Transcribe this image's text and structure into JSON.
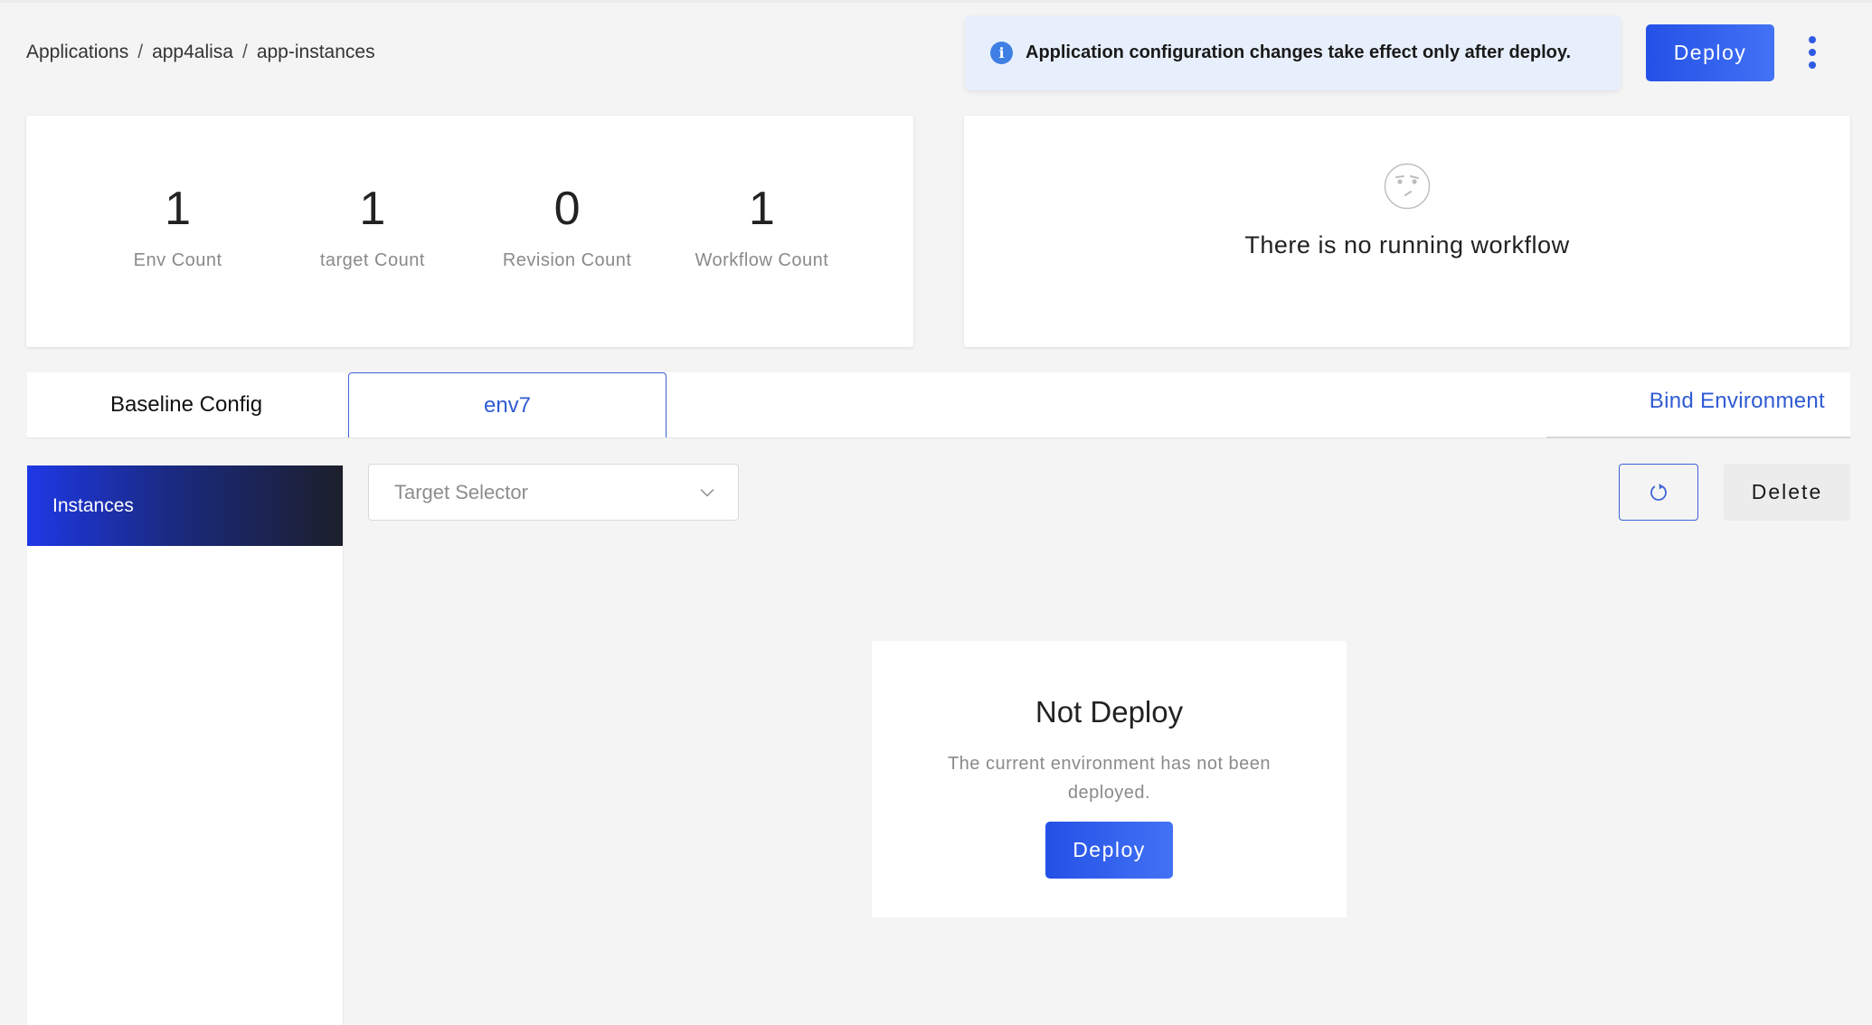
{
  "breadcrumb": [
    {
      "label": "Applications"
    },
    {
      "label": "app4alisa"
    },
    {
      "label": "app-instances"
    }
  ],
  "breadcrumb_separator": "/",
  "banner": {
    "icon": "info-icon",
    "message": "Application configuration changes take effect only after deploy."
  },
  "header": {
    "deploy_label": "Deploy",
    "more_icon": "kebab-menu-icon"
  },
  "stats": [
    {
      "value": "1",
      "label": "Env Count"
    },
    {
      "value": "1",
      "label": "target Count"
    },
    {
      "value": "0",
      "label": "Revision Count"
    },
    {
      "value": "1",
      "label": "Workflow Count"
    }
  ],
  "workflow": {
    "icon": "confused-face-icon",
    "message": "There is no running workflow"
  },
  "tabs": [
    {
      "label": "Baseline Config",
      "active": false
    },
    {
      "label": "env7",
      "active": true
    }
  ],
  "bind_environment_label": "Bind Environment",
  "sidebar": {
    "items": [
      {
        "label": "Instances",
        "active": true
      }
    ]
  },
  "toolbar": {
    "target_selector_placeholder": "Target Selector",
    "refresh_icon": "refresh-icon",
    "delete_label": "Delete"
  },
  "empty_state": {
    "title": "Not Deploy",
    "description": "The current environment has not been deployed.",
    "deploy_label": "Deploy"
  },
  "colors": {
    "primary": "#2f5be4",
    "link": "#2f5bd3",
    "banner_bg": "#e7effc",
    "info": "#3f7fe4",
    "page_bg": "#f4f4f4"
  }
}
